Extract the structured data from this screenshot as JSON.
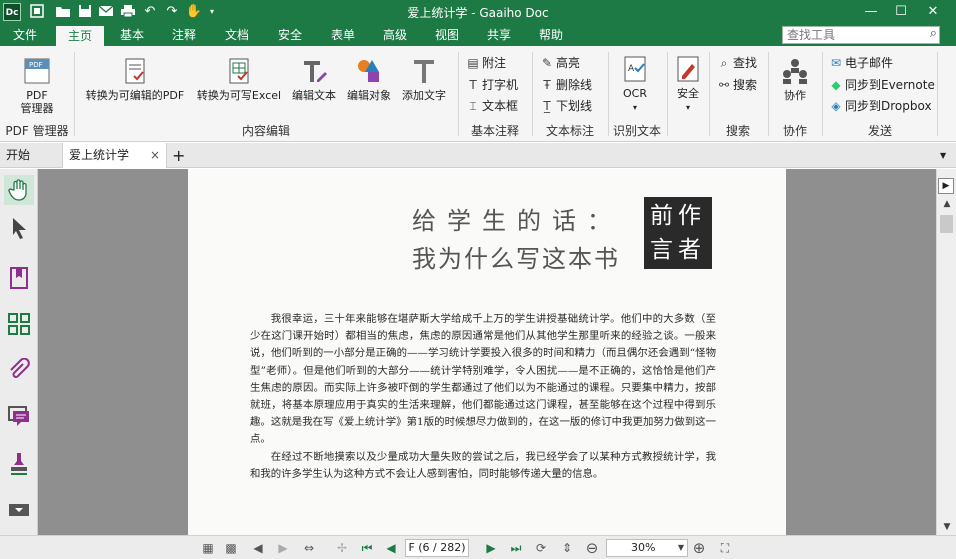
{
  "app": {
    "title": "爱上统计学 - Gaaiho Doc",
    "logo_text": "Dc",
    "window_controls": [
      "minimize",
      "maximize",
      "close"
    ]
  },
  "quick_access": [
    "new-icon",
    "open-folder-icon",
    "save-icon",
    "email-icon",
    "print-icon",
    "undo-icon",
    "redo-icon",
    "hand-tool-icon"
  ],
  "menu": {
    "items": [
      "文件",
      "主页",
      "基本",
      "注释",
      "文档",
      "安全",
      "表单",
      "高级",
      "视图",
      "共享",
      "帮助"
    ],
    "active": "主页",
    "search_placeholder": "查找工具"
  },
  "ribbon": {
    "pdf_manager": {
      "label": "PDF\n管理器",
      "group": "PDF 管理器"
    },
    "content_edit": {
      "buttons": [
        "转换为可编辑的PDF",
        "转换为可写Excel",
        "编辑文本",
        "编辑对象",
        "添加文字"
      ],
      "group": "内容编辑"
    },
    "basic_annotation": {
      "items": [
        "附注",
        "打字机",
        "文本框"
      ],
      "group": "基本注释"
    },
    "text_markup": {
      "items": [
        "高亮",
        "删除线",
        "下划线"
      ],
      "group": "文本标注"
    },
    "ocr": {
      "label": "OCR",
      "group": "识别文本"
    },
    "security": {
      "label": "安全"
    },
    "search": {
      "items": [
        "查找",
        "搜索"
      ],
      "group": "搜索"
    },
    "collaborate": {
      "label": "协作",
      "group": "协作"
    },
    "send": {
      "items": [
        "电子邮件",
        "同步到Evernote",
        "同步到Dropbox"
      ],
      "group": "发送"
    }
  },
  "tabs": {
    "start": "开始",
    "document": "爱上统计学",
    "close_symbol": "×",
    "new_symbol": "+"
  },
  "document": {
    "heading_line1": "给学生的话：",
    "heading_line2": "我为什么写这本书",
    "box_line1": "前作",
    "box_line2": "言者",
    "paragraph1": "我很幸运，三十年来能够在堪萨斯大学给成千上万的学生讲授基础统计学。他们中的大多数（至少在这门课开始时）都相当的焦虑，焦虑的原因通常是他们从其他学生那里听来的经验之谈。一般来说，他们听到的一小部分是正确的——学习统计学要投入很多的时间和精力（而且偶尔还会遇到“怪物型”老师）。但是他们听到的大部分——统计学特别难学，令人困扰——是不正确的，这恰恰是他们产生焦虑的原因。而实际上许多被吓倒的学生都通过了他们以为不能通过的课程。只要集中精力，按部就班，将基本原理应用于真实的生活来理解，他们都能通过这门课程，甚至能够在这个过程中得到乐趣。这就是我在写《爱上统计学》第1版的时候想尽力做到的，在这一版的修订中我更加努力做到这一点。",
    "paragraph2": "在经过不断地摸索以及少量成功大量失败的尝试之后，我已经学会了以某种方式教授统计学，我和我的许多学生认为这种方式不会让人感到害怕，同时能够传递大量的信息。"
  },
  "navigation": {
    "page_display": "F (6 / 282)",
    "current_page": 6,
    "total_pages": 282,
    "zoom": "30%"
  },
  "colors": {
    "brand_green": "#1d7a45",
    "page_background": "#8f8f8f"
  }
}
